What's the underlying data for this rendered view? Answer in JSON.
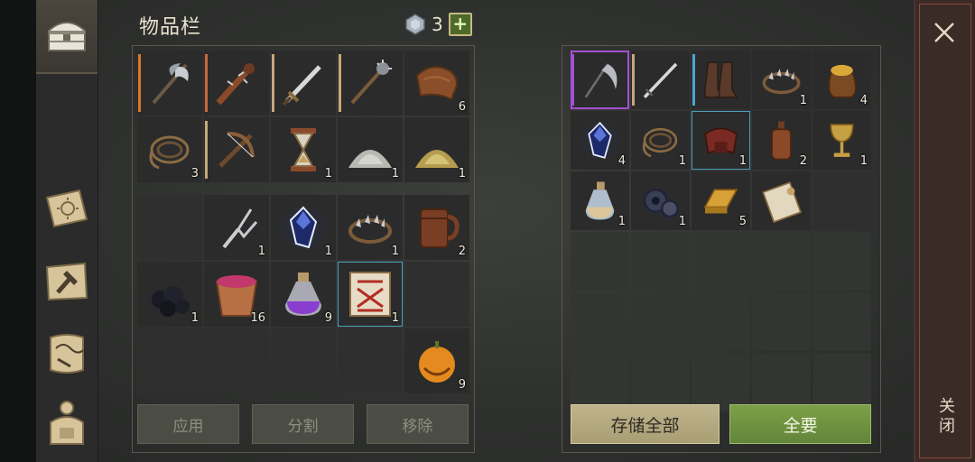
{
  "inventory": {
    "title": "物品栏",
    "gem_count": "3",
    "add_label": "+",
    "equip_rows": [
      [
        {
          "icon": "halberd-icon",
          "qty": "",
          "bar": "#d9772a"
        },
        {
          "icon": "spiked-club-icon",
          "qty": "",
          "bar": "#c96a3a"
        },
        {
          "icon": "sword-icon",
          "qty": "",
          "bar": "#c7a87a"
        },
        {
          "icon": "mace-icon",
          "qty": "",
          "bar": "#c7a87a"
        },
        {
          "icon": "leather-icon",
          "qty": "6",
          "bar": ""
        }
      ],
      [
        {
          "icon": "rope-icon",
          "qty": "3",
          "bar": ""
        },
        {
          "icon": "crossbow-icon",
          "qty": "",
          "bar": "#c7a87a"
        },
        {
          "icon": "hourglass-icon",
          "qty": "1",
          "bar": ""
        },
        {
          "icon": "powder-pile-icon",
          "qty": "1",
          "bar": ""
        },
        {
          "icon": "sulfur-pile-icon",
          "qty": "1",
          "bar": ""
        }
      ]
    ],
    "bag_rows": [
      [
        {
          "icon": "",
          "qty": ""
        },
        {
          "icon": "tuning-fork-icon",
          "qty": "1"
        },
        {
          "icon": "crystal-icon",
          "qty": "1"
        },
        {
          "icon": "bear-trap-icon",
          "qty": "1"
        },
        {
          "icon": "mug-icon",
          "qty": "2"
        }
      ],
      [
        {
          "icon": "coal-icon",
          "qty": "1"
        },
        {
          "icon": "berry-bucket-icon",
          "qty": "16"
        },
        {
          "icon": "purple-potion-icon",
          "qty": "9"
        },
        {
          "icon": "red-scroll-icon",
          "qty": "1",
          "selected": true
        },
        {
          "icon": "",
          "qty": ""
        }
      ],
      [
        {
          "icon": "",
          "qty": ""
        },
        {
          "icon": "",
          "qty": ""
        },
        {
          "icon": "",
          "qty": ""
        },
        {
          "icon": "",
          "qty": ""
        },
        {
          "icon": "pumpkin-icon",
          "qty": "9"
        }
      ]
    ],
    "buttons": {
      "apply": "应用",
      "split": "分割",
      "remove": "移除"
    }
  },
  "storage": {
    "rows": [
      [
        {
          "icon": "scythe-icon",
          "qty": "",
          "bar": "#a64fd6",
          "frame": "#a64fd6"
        },
        {
          "icon": "longsword-icon",
          "qty": "",
          "bar": "#c7a87a"
        },
        {
          "icon": "boots-icon",
          "qty": "",
          "bar": "#4ba8d0"
        },
        {
          "icon": "bear-trap-icon",
          "qty": "1"
        },
        {
          "icon": "gold-sack-icon",
          "qty": "4"
        }
      ],
      [
        {
          "icon": "crystal-icon",
          "qty": "4"
        },
        {
          "icon": "rope-icon",
          "qty": "1"
        },
        {
          "icon": "saddle-icon",
          "qty": "1",
          "selected": true
        },
        {
          "icon": "bottle-icon",
          "qty": "2"
        },
        {
          "icon": "goblet-icon",
          "qty": "1"
        }
      ],
      [
        {
          "icon": "blue-potion-icon",
          "qty": "1"
        },
        {
          "icon": "gear-icon",
          "qty": "1"
        },
        {
          "icon": "gold-bar-icon",
          "qty": "5"
        },
        {
          "icon": "paper-roll-icon",
          "qty": ""
        },
        {
          "icon": "",
          "qty": ""
        }
      ],
      [
        {
          "icon": "",
          "qty": ""
        },
        {
          "icon": "",
          "qty": ""
        },
        {
          "icon": "",
          "qty": ""
        },
        {
          "icon": "",
          "qty": ""
        },
        {
          "icon": "",
          "qty": ""
        }
      ],
      [
        {
          "icon": "",
          "qty": ""
        },
        {
          "icon": "",
          "qty": ""
        },
        {
          "icon": "",
          "qty": ""
        },
        {
          "icon": "",
          "qty": ""
        },
        {
          "icon": "",
          "qty": ""
        }
      ],
      [
        {
          "icon": "",
          "qty": ""
        },
        {
          "icon": "",
          "qty": ""
        },
        {
          "icon": "",
          "qty": ""
        },
        {
          "icon": "",
          "qty": ""
        },
        {
          "icon": "",
          "qty": ""
        }
      ]
    ],
    "buttons": {
      "store_all": "存储全部",
      "take_all": "全要"
    }
  },
  "close": {
    "label": "关闭"
  }
}
